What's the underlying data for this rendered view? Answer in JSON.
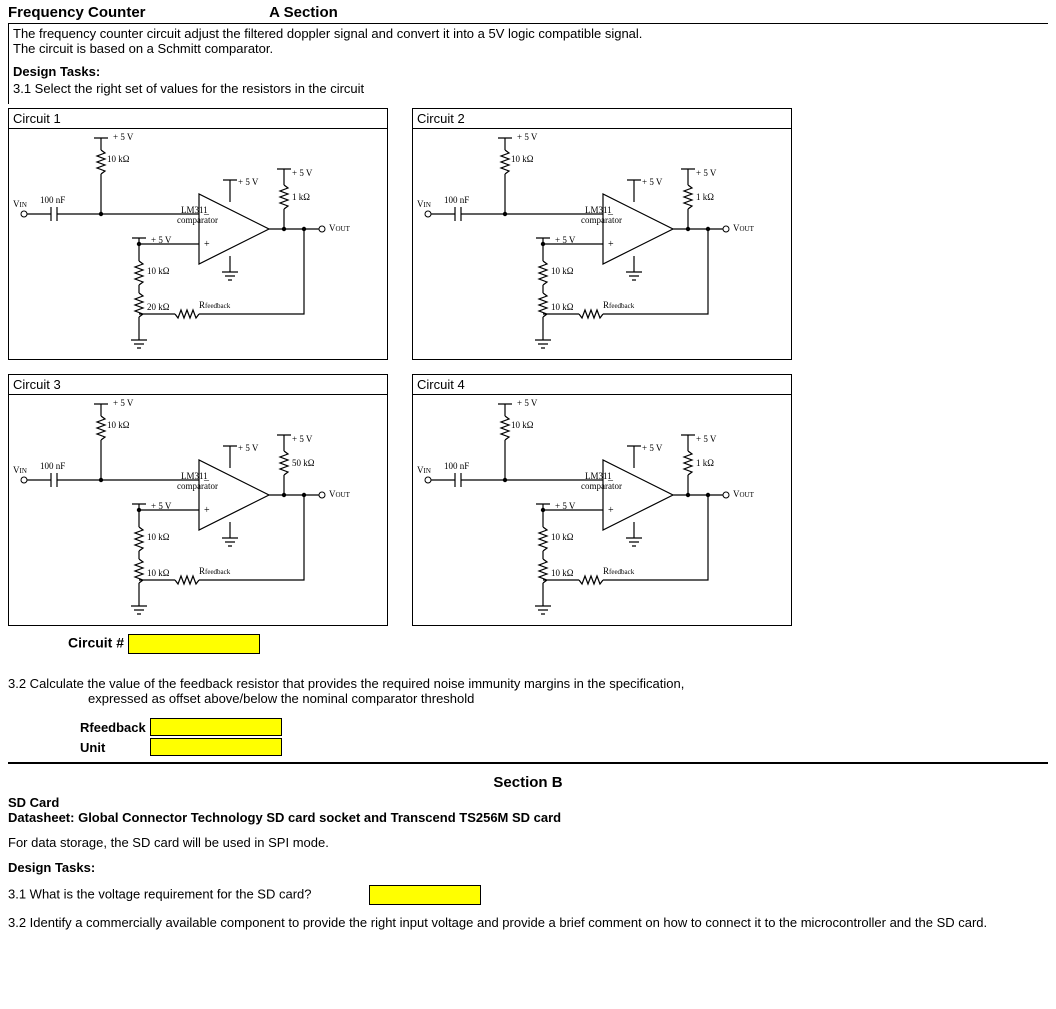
{
  "sectionA": {
    "title": "Frequency Counter",
    "label": "A Section",
    "intro1": "The frequency counter circuit adjust the filtered doppler signal and convert it into a 5V logic compatible signal.",
    "intro2": "The circuit is based on a Schmitt comparator.",
    "tasksHeading": "Design Tasks:",
    "task31": "3.1 Select the right set of values for the resistors in the circuit",
    "circuitPrompt": "Circuit #",
    "task32": "3.2 Calculate the value of the feedback resistor that provides the required noise immunity margins in the specification,",
    "task32b": "expressed as offset above/below the nominal comparator threshold",
    "rfeedbackLabel": "Rfeedback",
    "unitLabel": "Unit"
  },
  "circuits": [
    {
      "title": "Circuit 1",
      "values": {
        "cap": "100 nF",
        "vin": "V",
        "vinSub": "IN",
        "r1": "10 kΩ",
        "vtop": "+ 5 V",
        "opamp": "LM311",
        "opampSub": "comparator",
        "vopamp": "+ 5 V",
        "vpull": "+ 5 V",
        "rpull": "1 kΩ",
        "vout": "V",
        "voutSub": "OUT",
        "vmid": "+ 5 V",
        "r2": "10 kΩ",
        "r3": "20 kΩ",
        "rfb": "R",
        "rfbSub": "feedback"
      }
    },
    {
      "title": "Circuit 2",
      "values": {
        "cap": "100 nF",
        "vin": "V",
        "vinSub": "IN",
        "r1": "10 kΩ",
        "vtop": "+ 5 V",
        "opamp": "LM311",
        "opampSub": "comparator",
        "vopamp": "+ 5 V",
        "vpull": "+ 5 V",
        "rpull": "1 kΩ",
        "vout": "V",
        "voutSub": "OUT",
        "vmid": "+ 5 V",
        "r2": "10 kΩ",
        "r3": "10 kΩ",
        "rfb": "R",
        "rfbSub": "feedback"
      }
    },
    {
      "title": "Circuit 3",
      "values": {
        "cap": "100 nF",
        "vin": "V",
        "vinSub": "IN",
        "r1": "10 kΩ",
        "vtop": "+ 5 V",
        "opamp": "LM311",
        "opampSub": "comparator",
        "vopamp": "+ 5 V",
        "vpull": "+ 5 V",
        "rpull": "50 kΩ",
        "vout": "V",
        "voutSub": "OUT",
        "vmid": "+ 5 V",
        "r2": "10 kΩ",
        "r3": "10 kΩ",
        "rfb": "R",
        "rfbSub": "feedback"
      }
    },
    {
      "title": "Circuit 4",
      "values": {
        "cap": "100 nF",
        "vin": "V",
        "vinSub": "IN",
        "r1": "10 kΩ",
        "vtop": "+ 5 V",
        "opamp": "LM311",
        "opampSub": "comparator",
        "vopamp": "+ 5 V",
        "vpull": "+ 5 V",
        "rpull": "1 kΩ",
        "vout": "V",
        "voutSub": "OUT",
        "vmid": "+ 5 V",
        "r2": "10 kΩ",
        "r3": "10 kΩ",
        "rfb": "R",
        "rfbSub": "feedback"
      }
    }
  ],
  "sectionB": {
    "label": "Section B",
    "heading": "SD Card",
    "datasheet": "Datasheet: Global Connector Technology SD card socket and Transcend TS256M SD card",
    "intro": "For data storage, the SD card will be used in SPI mode.",
    "tasksHeading": "Design Tasks:",
    "q31": "3.1 What is the voltage requirement for the SD card?",
    "q32": "3.2 Identify a commercially available component to provide the right input voltage and provide a brief comment on how to connect it to the microcontroller and the SD card."
  }
}
